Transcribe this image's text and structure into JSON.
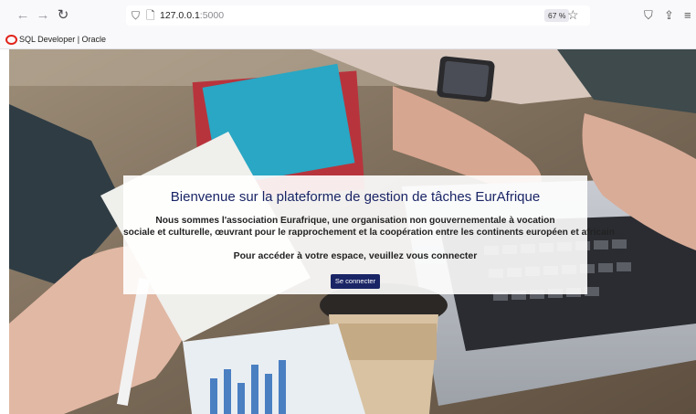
{
  "browser": {
    "url_host": "127.0.0.1",
    "url_port": ":5000",
    "zoom": "67 %",
    "bookmark_label": "SQL Developer | Oracle"
  },
  "page": {
    "title": "Bienvenue sur la plateforme de gestion de tâches EurAfrique",
    "description_line1": "Nous sommes l'association Eurafrique, une organisation non gouvernementale à vocation",
    "description_line2": "sociale et culturelle, œuvrant pour le rapprochement et la coopération entre les continents européen et africain",
    "prompt": "Pour accéder à votre espace, veuillez vous connecter",
    "login_button": "Se connecter"
  },
  "colors": {
    "title": "#1a2566",
    "button_bg": "#1a2566",
    "oracle_red": "#e2231a"
  },
  "icons": {
    "back": "arrow-left-icon",
    "forward": "arrow-right-icon",
    "reload": "reload-icon",
    "shield": "shield-icon",
    "page": "page-icon",
    "bookmark_star": "star-icon",
    "pocket": "pocket-icon",
    "share": "share-icon",
    "menu": "hamburger-menu-icon"
  }
}
